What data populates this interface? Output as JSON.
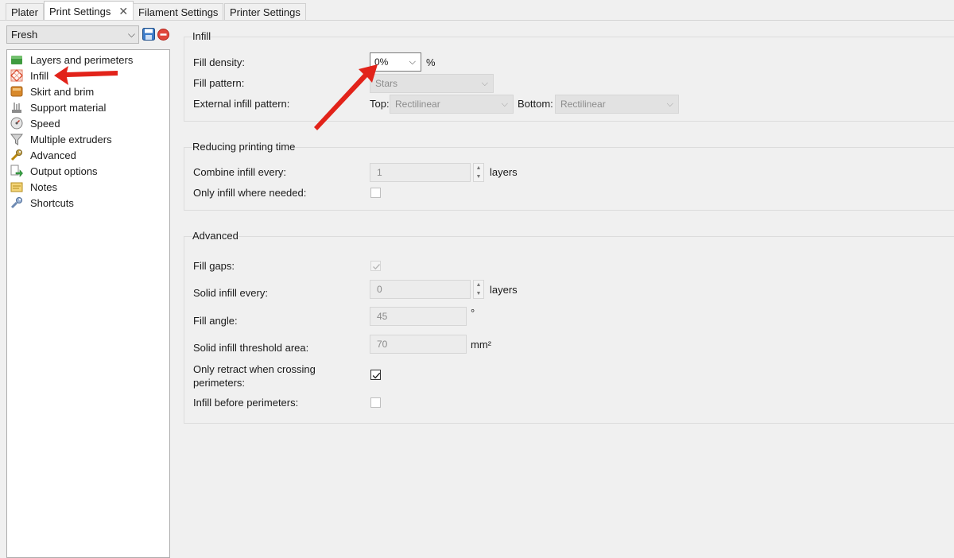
{
  "tabs": [
    {
      "label": "Plater"
    },
    {
      "label": "Print Settings",
      "close": "✕"
    },
    {
      "label": "Filament Settings"
    },
    {
      "label": "Printer Settings"
    }
  ],
  "preset": {
    "value": "Fresh"
  },
  "tree": [
    {
      "label": "Layers and perimeters",
      "icon": "layers-icon"
    },
    {
      "label": "Infill",
      "icon": "infill-icon"
    },
    {
      "label": "Skirt and brim",
      "icon": "skirt-brim-icon"
    },
    {
      "label": "Support material",
      "icon": "support-material-icon"
    },
    {
      "label": "Speed",
      "icon": "speed-icon"
    },
    {
      "label": "Multiple extruders",
      "icon": "funnel-icon"
    },
    {
      "label": "Advanced",
      "icon": "wrench-icon"
    },
    {
      "label": "Output options",
      "icon": "output-icon"
    },
    {
      "label": "Notes",
      "icon": "notes-icon"
    },
    {
      "label": "Shortcuts",
      "icon": "shortcuts-icon"
    }
  ],
  "infill_group": {
    "title": "Infill",
    "fill_density": {
      "label": "Fill density:",
      "value": "0%",
      "unit": "%"
    },
    "fill_pattern": {
      "label": "Fill pattern:",
      "value": "Stars"
    },
    "external_pattern": {
      "label": "External infill pattern:",
      "top_label": "Top:",
      "top_value": "Rectilinear",
      "bottom_label": "Bottom:",
      "bottom_value": "Rectilinear"
    }
  },
  "reducing_group": {
    "title": "Reducing printing time",
    "combine_every": {
      "label": "Combine infill every:",
      "value": "1",
      "unit": "layers"
    },
    "only_where_needed": {
      "label": "Only infill where needed:",
      "checked": false
    }
  },
  "advanced_group": {
    "title": "Advanced",
    "fill_gaps": {
      "label": "Fill gaps:",
      "checked": true
    },
    "solid_every": {
      "label": "Solid infill every:",
      "value": "0",
      "unit": "layers"
    },
    "fill_angle": {
      "label": "Fill angle:",
      "value": "45",
      "unit": "°"
    },
    "solid_threshold": {
      "label": "Solid infill threshold area:",
      "value": "70",
      "unit": "mm²"
    },
    "only_retract": {
      "label_line1": "Only retract when crossing",
      "label_line2": "perimeters:",
      "checked": true
    },
    "infill_before": {
      "label": "Infill before perimeters:",
      "checked": false
    }
  },
  "colors": {
    "annotation_arrow": "#e2231a"
  }
}
